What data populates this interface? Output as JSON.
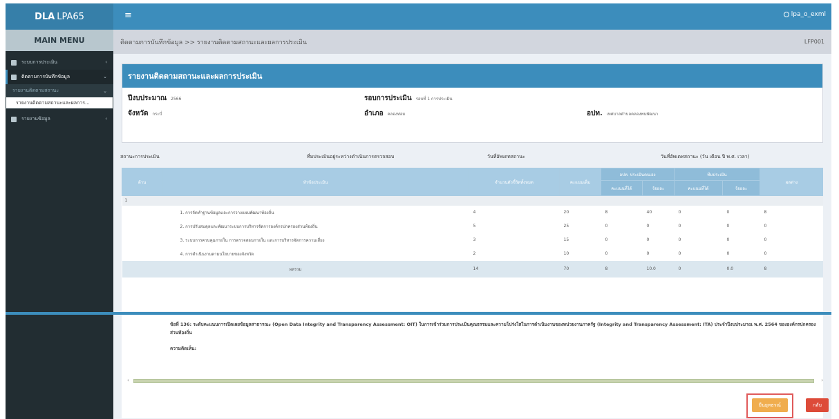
{
  "header": {
    "brand_main": "DLA",
    "brand_sub": "LPA65",
    "hamburger": "≡",
    "user": "lpa_o_exml"
  },
  "sidebar": {
    "menu_header": "MAIN MENU",
    "items": [
      {
        "label": "ระบบการประเมิน",
        "chev": "‹"
      },
      {
        "label": "ติดตามการบันทึกข้อมูล",
        "chev": "⌄"
      },
      {
        "label": "รายงานติดตามสถานะ",
        "chev": "⌄"
      },
      {
        "label": "รายงานติดตามสถานะและผลการ..."
      },
      {
        "label": "รายงานข้อมูล",
        "chev": "‹"
      }
    ]
  },
  "breadcrumb": {
    "path": "ติดตามการบันทึกข้อมูล >> รายงานติดตามสถานะและผลการประเมิน",
    "code": "LFP001"
  },
  "panel": {
    "title": "รายงานติดตามสถานะและผลการประเมิน",
    "fiscal_year_label": "ปีงบประมาณ",
    "fiscal_year_value": "2566",
    "round_label": "รอบการประเมิน",
    "round_value": "รอบที่ 1 การประเมิน",
    "province_label": "จังหวัด",
    "province_value": "กระบี่",
    "district_label": "อำเภอ",
    "district_value": "คลองท่อม",
    "org_label": "อปท.",
    "org_value": "เทศบาลตำบลคลองพนพัฒนา"
  },
  "status": {
    "state": "สถานะการประเมิน",
    "progress": "ที่มประเมินอยู่ระหว่างดำเนินการตรวจสอบ",
    "updated": "วันที่อัพเดทสถานะ",
    "updated_format": "วันที่อัพเดทสถานะ (วัน เดือน ปี พ.ศ. เวลา)"
  },
  "table": {
    "headers": {
      "side": "ด้าน",
      "topic": "หัวข้อประเมิน",
      "indicators": "จำนวนตัวชี้วัดทั้งหมด",
      "full_score": "คะแนนเต็ม",
      "self_group": "อปท. ประเมินตนเอง",
      "team_group": "ทีมประเมิน",
      "score": "คะแนนที่ได้",
      "percent": "ร้อยละ",
      "diff": "ผลต่าง"
    },
    "group": "1",
    "rows": [
      {
        "topic": "1. การจัดทำฐานข้อมูลและการวางแผนพัฒนาท้องถิ่น",
        "indicators": "4",
        "full": "20",
        "self_score": "8",
        "self_pct": "40",
        "team_score": "0",
        "team_pct": "0",
        "diff": "8"
      },
      {
        "topic": "2. การปรับสมดุลและพัฒนาระบบการบริหารจัดการองค์กรปกครองส่วนท้องถิ่น",
        "indicators": "5",
        "full": "25",
        "self_score": "0",
        "self_pct": "0",
        "team_score": "0",
        "team_pct": "0",
        "diff": "0"
      },
      {
        "topic": "3. ระบบการควบคุมภายใน การตรวจสอบภายใน และการบริหารจัดการความเสี่ยง",
        "indicators": "3",
        "full": "15",
        "self_score": "0",
        "self_pct": "0",
        "team_score": "0",
        "team_pct": "0",
        "diff": "0"
      },
      {
        "topic": "4. การดำเนินงานตามนโยบายของจังหวัด",
        "indicators": "2",
        "full": "10",
        "self_score": "0",
        "self_pct": "0",
        "team_score": "0",
        "team_pct": "0",
        "diff": "0"
      }
    ],
    "total": {
      "label": "ผลรวม",
      "indicators": "14",
      "full": "70",
      "self_score": "8",
      "self_pct": "10.0",
      "team_score": "0",
      "team_pct": "0.0",
      "diff": "8"
    }
  },
  "lower": {
    "note": "ข้อที่ 136: ระดับคะแนนการเปิดเผยข้อมูลสาธารณะ (Open Data Integrity and Transparency Assessment: OIT) ในการเข้าร่วมการประเมินคุณธรรมและความโปร่งใสในการดำเนินงานของหน่วยงานภาครัฐ (Integrity and Transparency Assessment: ITA) ประจำปีงบประมาณ พ.ศ. 2564 ขององค์กรปกครองส่วนท้องถิ่น",
    "opinion": "ความคิดเห็น:",
    "arrow_left": "‹",
    "arrow_right": "›"
  },
  "buttons": {
    "confirm": "ยืนยุทธรณ์",
    "back": "กลับ"
  },
  "colors": {
    "primary": "#3c8dbc",
    "sidebar_bg": "#222d32",
    "confirm": "#f0ad4e",
    "back": "#dd4b39"
  }
}
